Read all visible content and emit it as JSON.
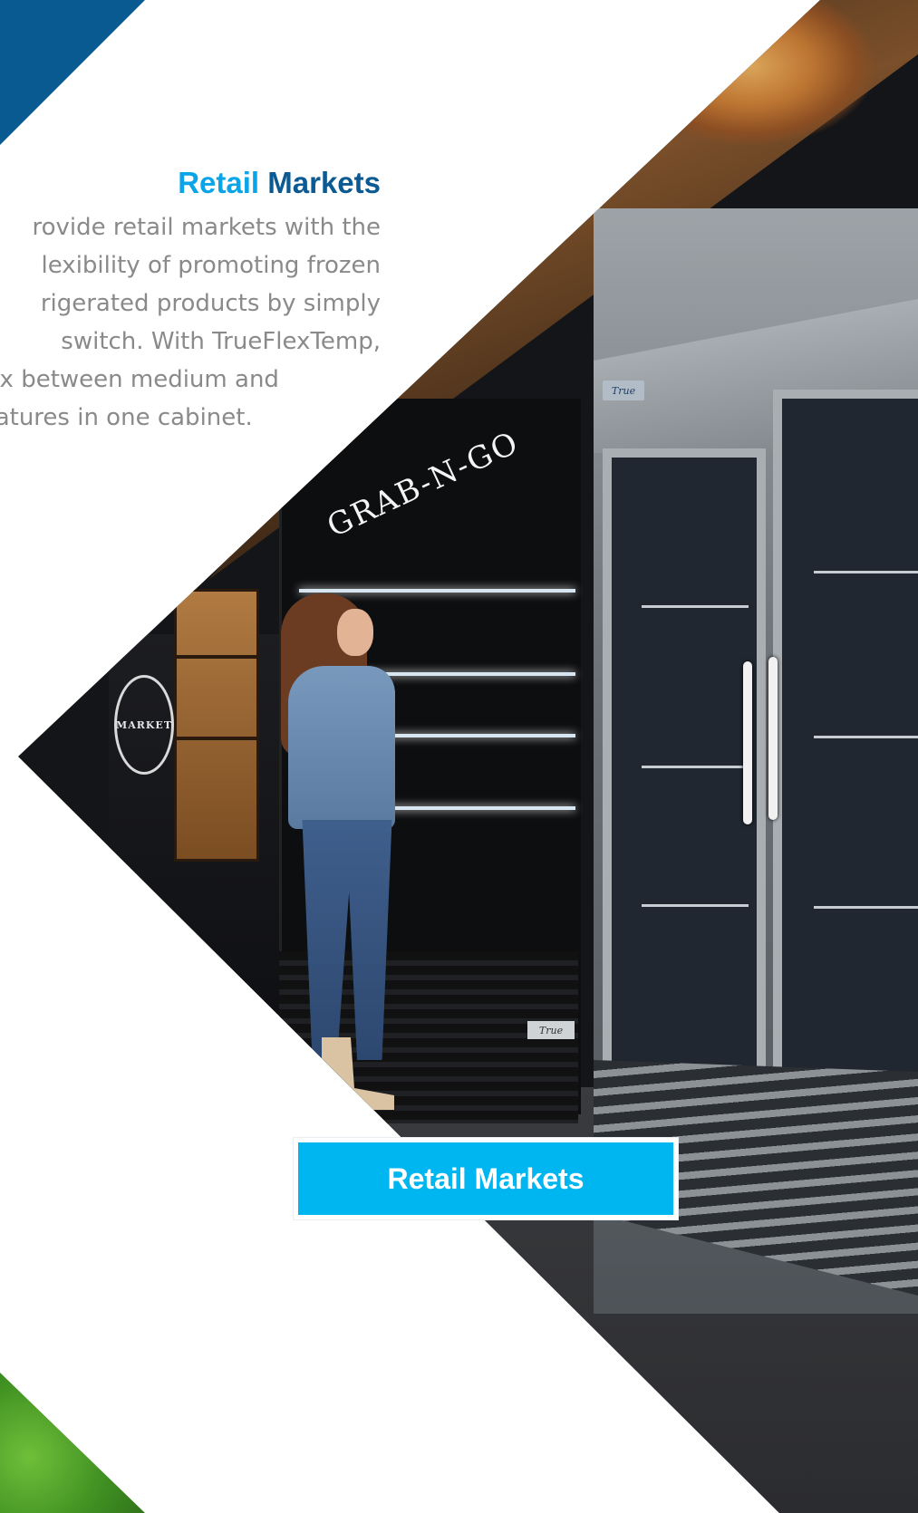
{
  "headline": {
    "part1": "Retail",
    "part2": "Markets"
  },
  "body_lines": [
    "rovide retail markets with the",
    "lexibility of promoting frozen",
    "rigerated products by simply",
    "switch. With TrueFlexTemp,",
    "ex between medium and",
    "ratures in one cabinet."
  ],
  "cta_label": "Retail Markets",
  "photo": {
    "case_sign": "GRAB-N-GO",
    "wall_logo": "MARKET",
    "cabinet_badge": "True"
  },
  "colors": {
    "accent_light_blue": "#0aa5e8",
    "accent_dark_blue": "#0b5a92",
    "cta_background": "#00b6f1",
    "body_text": "#8a8a8a"
  }
}
